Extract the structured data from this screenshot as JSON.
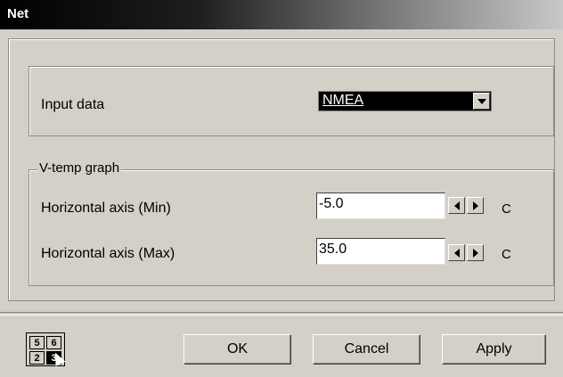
{
  "window": {
    "title": "Net"
  },
  "input_data": {
    "label": "Input data",
    "selected": "NMEA"
  },
  "vtemp_group": {
    "legend": "V-temp graph",
    "rows": [
      {
        "label": "Horizontal axis (Min)",
        "value": "-5.0",
        "unit": "C"
      },
      {
        "label": "Horizontal axis (Max)",
        "value": "35.0",
        "unit": "C"
      }
    ]
  },
  "page_grid": {
    "cells": [
      "5",
      "6",
      "2",
      "3"
    ]
  },
  "buttons": {
    "ok": "OK",
    "cancel": "Cancel",
    "apply": "Apply"
  }
}
